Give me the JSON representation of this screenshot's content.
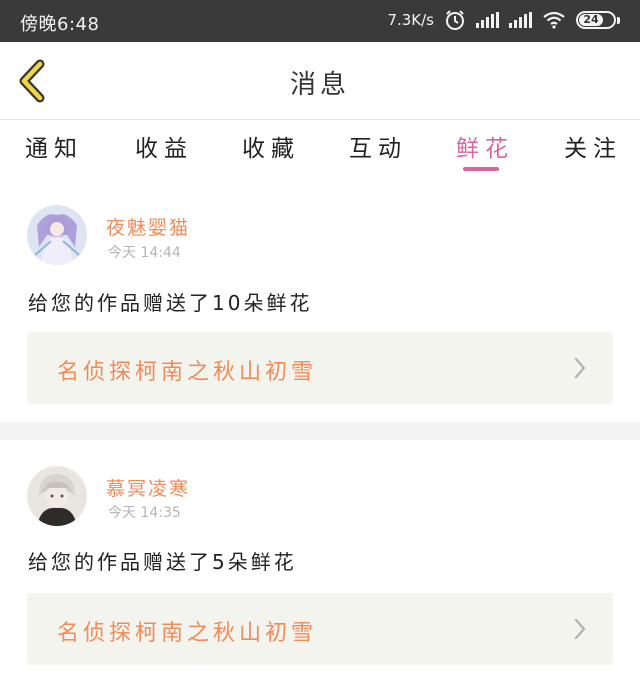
{
  "status_bar": {
    "time": "傍晚6:48",
    "net_speed": "7.3K/s",
    "battery": "24"
  },
  "nav": {
    "title": "消息"
  },
  "tabs": [
    {
      "label": "通知",
      "active": false
    },
    {
      "label": "收益",
      "active": false
    },
    {
      "label": "收藏",
      "active": false
    },
    {
      "label": "互动",
      "active": false
    },
    {
      "label": "鲜花",
      "active": true
    },
    {
      "label": "关注",
      "active": false
    }
  ],
  "messages": [
    {
      "username": "夜魅婴猫",
      "time": "今天 14:44",
      "text": "给您的作品赠送了10朵鲜花",
      "work_title": "名侦探柯南之秋山初雪"
    },
    {
      "username": "慕冥凌寒",
      "time": "今天 14:35",
      "text": "给您的作品赠送了5朵鲜花",
      "work_title": "名侦探柯南之秋山初雪"
    }
  ],
  "colors": {
    "accent_pink": "#d9659f",
    "username_orange": "#ef8c5a",
    "status_bar_bg": "#3a3a3a"
  }
}
